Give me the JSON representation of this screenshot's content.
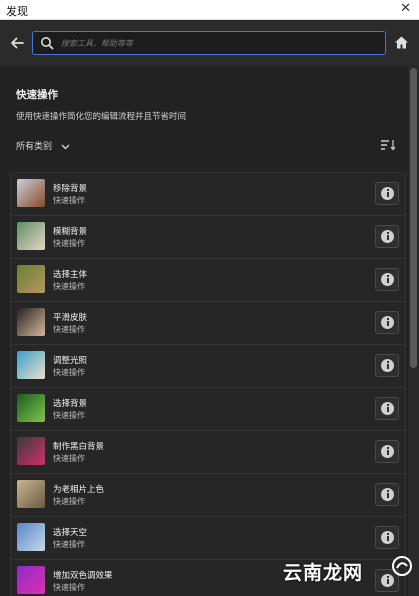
{
  "window": {
    "title": "发现",
    "close_glyph": "✕"
  },
  "search": {
    "placeholder": "搜索工具、帮助等等",
    "value": ""
  },
  "icons": {
    "back": "arrow-left-icon",
    "search": "search-icon",
    "home": "home-icon",
    "chevron": "chevron-down-icon",
    "sort": "sort-icon",
    "info": "info-icon"
  },
  "section": {
    "title": "快速操作",
    "description": "使用快速操作简化您的编辑流程并且节省时间",
    "filter_label": "所有类别"
  },
  "actions": [
    {
      "name": "移除背景",
      "subtitle": "快速操作",
      "thumb_colors": [
        "#c9d1d9",
        "#8a4a2a"
      ]
    },
    {
      "name": "模糊背景",
      "subtitle": "快速操作",
      "thumb_colors": [
        "#5b8f6a",
        "#e8d6c0"
      ]
    },
    {
      "name": "选择主体",
      "subtitle": "快速操作",
      "thumb_colors": [
        "#6a7d2f",
        "#b49a60"
      ]
    },
    {
      "name": "平滑皮肤",
      "subtitle": "快速操作",
      "thumb_colors": [
        "#222222",
        "#d8b69a"
      ]
    },
    {
      "name": "调整光照",
      "subtitle": "快速操作",
      "thumb_colors": [
        "#3aa0c8",
        "#e8e0d0"
      ]
    },
    {
      "name": "选择背景",
      "subtitle": "快速操作",
      "thumb_colors": [
        "#1e5a22",
        "#7fc64a"
      ]
    },
    {
      "name": "制作黑白背景",
      "subtitle": "快速操作",
      "thumb_colors": [
        "#3a3a3a",
        "#d0306a"
      ]
    },
    {
      "name": "为老相片上色",
      "subtitle": "快速操作",
      "thumb_colors": [
        "#c8b890",
        "#6a5a40"
      ]
    },
    {
      "name": "选择天空",
      "subtitle": "快速操作",
      "thumb_colors": [
        "#5a86c8",
        "#c8d8ea"
      ]
    },
    {
      "name": "增加双色调效果",
      "subtitle": "快速操作",
      "thumb_colors": [
        "#8a2ac8",
        "#e030b0"
      ]
    }
  ],
  "watermark": {
    "text": "云南龙网"
  },
  "colors": {
    "accent": "#3b7be0",
    "background": "#222222"
  }
}
